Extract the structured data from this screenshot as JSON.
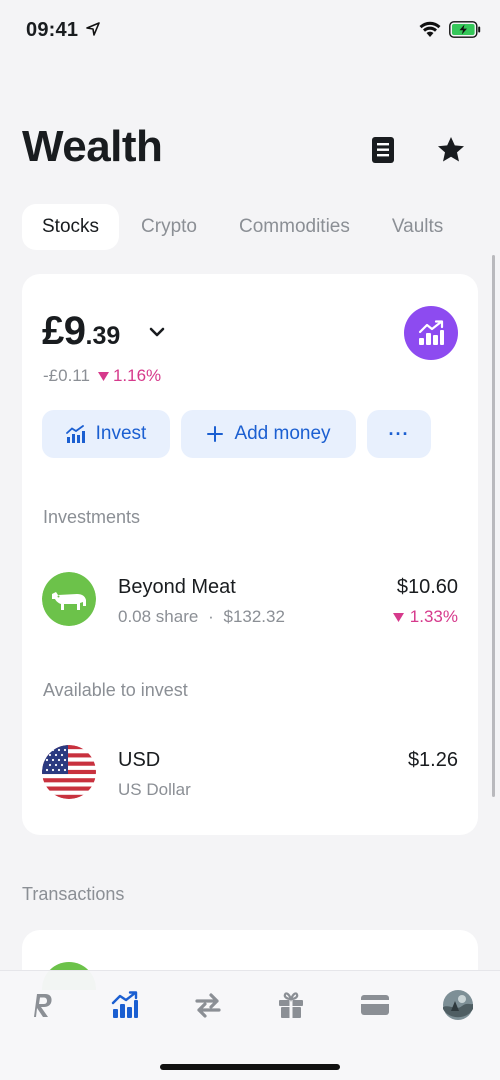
{
  "status_bar": {
    "time": "09:41"
  },
  "page": {
    "title": "Wealth"
  },
  "tabs": [
    {
      "label": "Stocks",
      "active": true
    },
    {
      "label": "Crypto",
      "active": false
    },
    {
      "label": "Commodities",
      "active": false
    },
    {
      "label": "Vaults",
      "active": false
    }
  ],
  "portfolio": {
    "balance_whole": "£9",
    "balance_decimal": ".39",
    "change_amount": "-£0.11",
    "change_percent": "1.16%",
    "actions": {
      "invest": "Invest",
      "add_money": "Add money",
      "more": "···"
    }
  },
  "investments": {
    "label": "Investments",
    "items": [
      {
        "name": "Beyond Meat",
        "shares": "0.08 share",
        "separator": "·",
        "price": "$132.32",
        "value": "$10.60",
        "change": "1.33%"
      }
    ]
  },
  "available": {
    "label": "Available to invest",
    "items": [
      {
        "code": "USD",
        "name": "US Dollar",
        "value": "$1.26"
      }
    ]
  },
  "transactions": {
    "label": "Transactions"
  },
  "colors": {
    "accent": "#1b5fd1",
    "negative": "#d63a8c",
    "analytics": "#8d4bf0",
    "beyond_meat": "#6cc24a"
  },
  "tab_bar": {
    "icons": [
      "revolut-logo-icon",
      "wealth-chart-icon",
      "transfers-icon",
      "rewards-gift-icon",
      "cards-icon",
      "profile-avatar"
    ]
  }
}
